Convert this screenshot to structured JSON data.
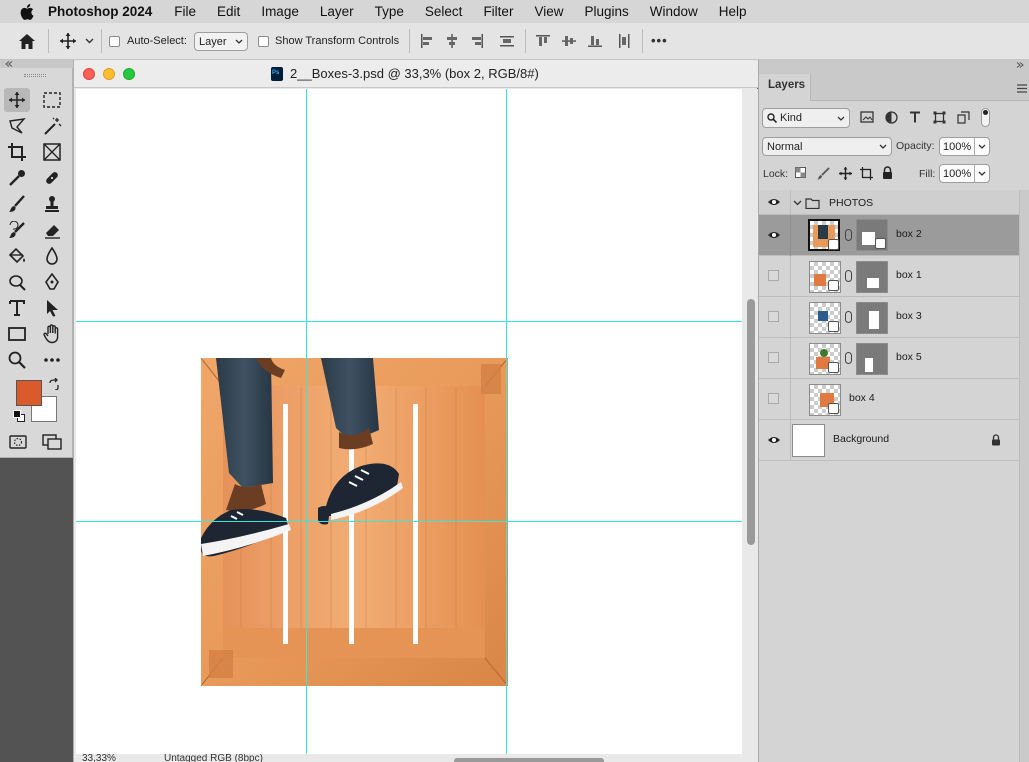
{
  "menubar": {
    "app_name": "Photoshop 2024",
    "items": [
      "File",
      "Edit",
      "Image",
      "Layer",
      "Type",
      "Select",
      "Filter",
      "View",
      "Plugins",
      "Window",
      "Help"
    ]
  },
  "options_bar": {
    "auto_select_label": "Auto-Select:",
    "auto_select_value": "Layer",
    "show_transform_label": "Show Transform Controls",
    "more_label": "•••"
  },
  "document": {
    "title": "2__Boxes-3.psd @ 33,3% (box 2, RGB/8#)",
    "zoom_status": "33,33%",
    "profile_status": "Untagged RGB (8bpc)"
  },
  "colors": {
    "foreground": "#d95a2b",
    "background": "#ffffff",
    "guide": "#32e6e6",
    "selected_row": "#9b9b9b"
  },
  "layers_panel": {
    "tab_label": "Layers",
    "filter_label": "Kind",
    "blend_mode": "Normal",
    "opacity_label": "Opacity:",
    "opacity_value": "100%",
    "lock_label": "Lock:",
    "fill_label": "Fill:",
    "fill_value": "100%",
    "group_name": "PHOTOS",
    "layers": [
      {
        "name": "box 2",
        "visible": true,
        "selected": true
      },
      {
        "name": "box 1",
        "visible": false,
        "selected": false
      },
      {
        "name": "box 3",
        "visible": false,
        "selected": false
      },
      {
        "name": "box 5",
        "visible": false,
        "selected": false
      },
      {
        "name": "box 4",
        "visible": false,
        "selected": false
      }
    ],
    "background_layer": "Background"
  }
}
